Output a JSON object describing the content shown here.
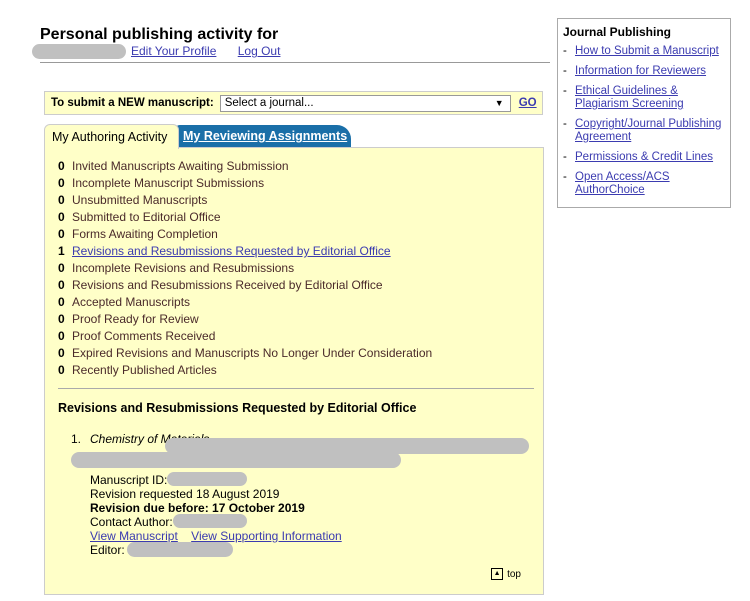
{
  "header": {
    "title": "Personal publishing activity for",
    "edit_profile": "Edit Your Profile",
    "logout": "Log Out"
  },
  "submit": {
    "label": "To submit a NEW manuscript:",
    "select_value": "Select a journal...",
    "go": "GO"
  },
  "tabs": [
    {
      "label": "My Authoring Activity"
    },
    {
      "label": "My Reviewing Assignments"
    }
  ],
  "activity": [
    {
      "count": "0",
      "label": "Invited Manuscripts Awaiting Submission"
    },
    {
      "count": "0",
      "label": "Incomplete Manuscript Submissions"
    },
    {
      "count": "0",
      "label": "Unsubmitted Manuscripts"
    },
    {
      "count": "0",
      "label": "Submitted to Editorial Office"
    },
    {
      "count": "0",
      "label": "Forms Awaiting Completion"
    },
    {
      "count": "1",
      "label": "Revisions and Resubmissions Requested by Editorial Office"
    },
    {
      "count": "0",
      "label": "Incomplete Revisions and Resubmissions"
    },
    {
      "count": "0",
      "label": "Revisions and Resubmissions Received by Editorial Office"
    },
    {
      "count": "0",
      "label": "Accepted Manuscripts"
    },
    {
      "count": "0",
      "label": "Proof Ready for Review"
    },
    {
      "count": "0",
      "label": "Proof Comments Received"
    },
    {
      "count": "0",
      "label": "Expired Revisions and Manuscripts No Longer Under Consideration"
    },
    {
      "count": "0",
      "label": "Recently Published Articles"
    }
  ],
  "section": {
    "title": "Revisions and Resubmissions Requested by Editorial Office",
    "item": {
      "num": "1.",
      "journal": "Chemistry of Materials",
      "manuscript_id": "Manuscript ID:",
      "revision_requested": "Revision requested 18 August 2019",
      "revision_due": "Revision due before: 17 October 2019",
      "contact_author": "Contact Author:",
      "view_manuscript": "View Manuscript",
      "view_si": "View Supporting Information",
      "editor": "Editor:"
    },
    "top": "top"
  },
  "sidebar": {
    "title": "Journal Publishing",
    "links": [
      "How to Submit a Manuscript",
      "Information for Reviewers",
      "Ethical Guidelines & Plagiarism Screening",
      "Copyright/Journal Publishing Agreement",
      "Permissions & Credit Lines",
      "Open Access/ACS AuthorChoice"
    ]
  }
}
